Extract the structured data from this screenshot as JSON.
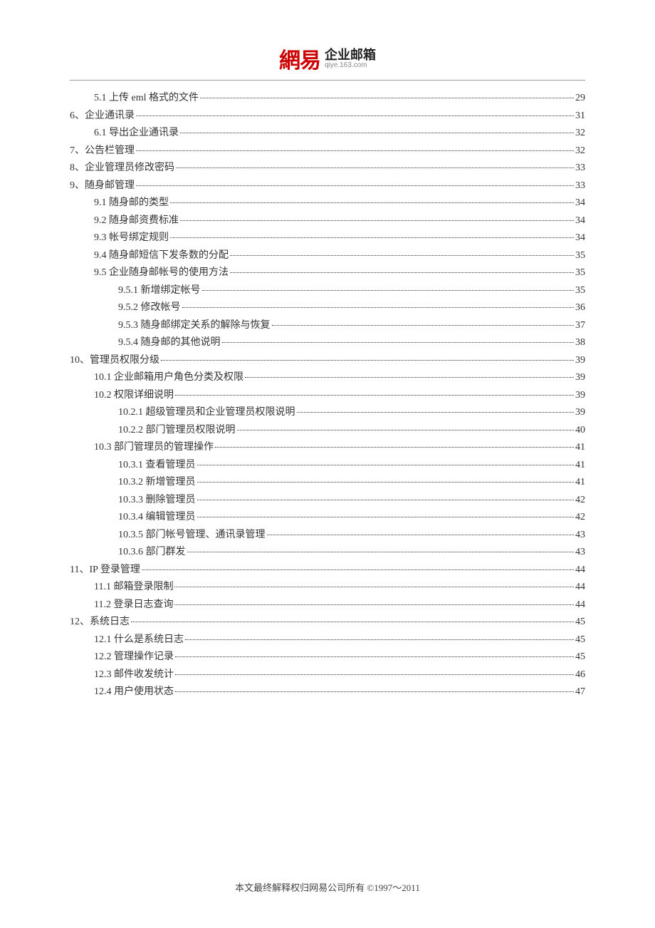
{
  "logo": {
    "brand": "網易",
    "title": "企业邮箱",
    "sub": "qiye.163.com"
  },
  "toc": [
    {
      "indent": 1,
      "label": "5.1  上传 eml 格式的文件",
      "page": "29"
    },
    {
      "indent": 0,
      "label": "6、企业通讯录",
      "page": "31"
    },
    {
      "indent": 1,
      "label": "6.1  导出企业通讯录",
      "page": "32"
    },
    {
      "indent": 0,
      "label": "7、公告栏管理",
      "page": "32"
    },
    {
      "indent": 0,
      "label": "8、企业管理员修改密码",
      "page": "33"
    },
    {
      "indent": 0,
      "label": "9、随身邮管理",
      "page": "33"
    },
    {
      "indent": 1,
      "label": "9.1  随身邮的类型",
      "page": "34"
    },
    {
      "indent": 1,
      "label": "9.2  随身邮资费标准",
      "page": "34"
    },
    {
      "indent": 1,
      "label": "9.3  帐号绑定规则",
      "page": "34"
    },
    {
      "indent": 1,
      "label": "9.4  随身邮短信下发条数的分配",
      "page": "35"
    },
    {
      "indent": 1,
      "label": "9.5  企业随身邮帐号的使用方法",
      "page": "35"
    },
    {
      "indent": 2,
      "label": "9.5.1  新增绑定帐号",
      "page": "35"
    },
    {
      "indent": 2,
      "label": "9.5.2  修改帐号",
      "page": "36"
    },
    {
      "indent": 2,
      "label": "9.5.3  随身邮绑定关系的解除与恢复",
      "page": "37"
    },
    {
      "indent": 2,
      "label": "9.5.4  随身邮的其他说明",
      "page": "38"
    },
    {
      "indent": 0,
      "label": "10、管理员权限分级",
      "page": "39"
    },
    {
      "indent": 1,
      "label": "10.1  企业邮箱用户角色分类及权限",
      "page": "39"
    },
    {
      "indent": 1,
      "label": "10.2  权限详细说明",
      "page": "39"
    },
    {
      "indent": 2,
      "label": "10.2.1  超级管理员和企业管理员权限说明",
      "page": "39"
    },
    {
      "indent": 2,
      "label": "10.2.2  部门管理员权限说明",
      "page": "40"
    },
    {
      "indent": 1,
      "label": "10.3  部门管理员的管理操作",
      "page": "41"
    },
    {
      "indent": 2,
      "label": "10.3.1  查看管理员",
      "page": "41"
    },
    {
      "indent": 2,
      "label": "10.3.2  新增管理员",
      "page": "41"
    },
    {
      "indent": 2,
      "label": "10.3.3  删除管理员",
      "page": "42"
    },
    {
      "indent": 2,
      "label": "10.3.4  编辑管理员",
      "page": "42"
    },
    {
      "indent": 2,
      "label": "10.3.5  部门帐号管理、通讯录管理",
      "page": "43"
    },
    {
      "indent": 2,
      "label": "10.3.6  部门群发",
      "page": "43"
    },
    {
      "indent": 0,
      "label": "11、IP 登录管理",
      "page": "44"
    },
    {
      "indent": 1,
      "label": "11.1  邮箱登录限制",
      "page": "44"
    },
    {
      "indent": 1,
      "label": "11.2  登录日志查询",
      "page": "44"
    },
    {
      "indent": 0,
      "label": "12、系统日志",
      "page": "45"
    },
    {
      "indent": 1,
      "label": "12.1  什么是系统日志",
      "page": "45"
    },
    {
      "indent": 1,
      "label": "12.2  管理操作记录",
      "page": "45"
    },
    {
      "indent": 1,
      "label": "12.3  邮件收发统计",
      "page": "46"
    },
    {
      "indent": 1,
      "label": "12.4 用户使用状态",
      "page": "47"
    }
  ],
  "footer": "本文最终解释权归网易公司所有  ©1997～2011"
}
